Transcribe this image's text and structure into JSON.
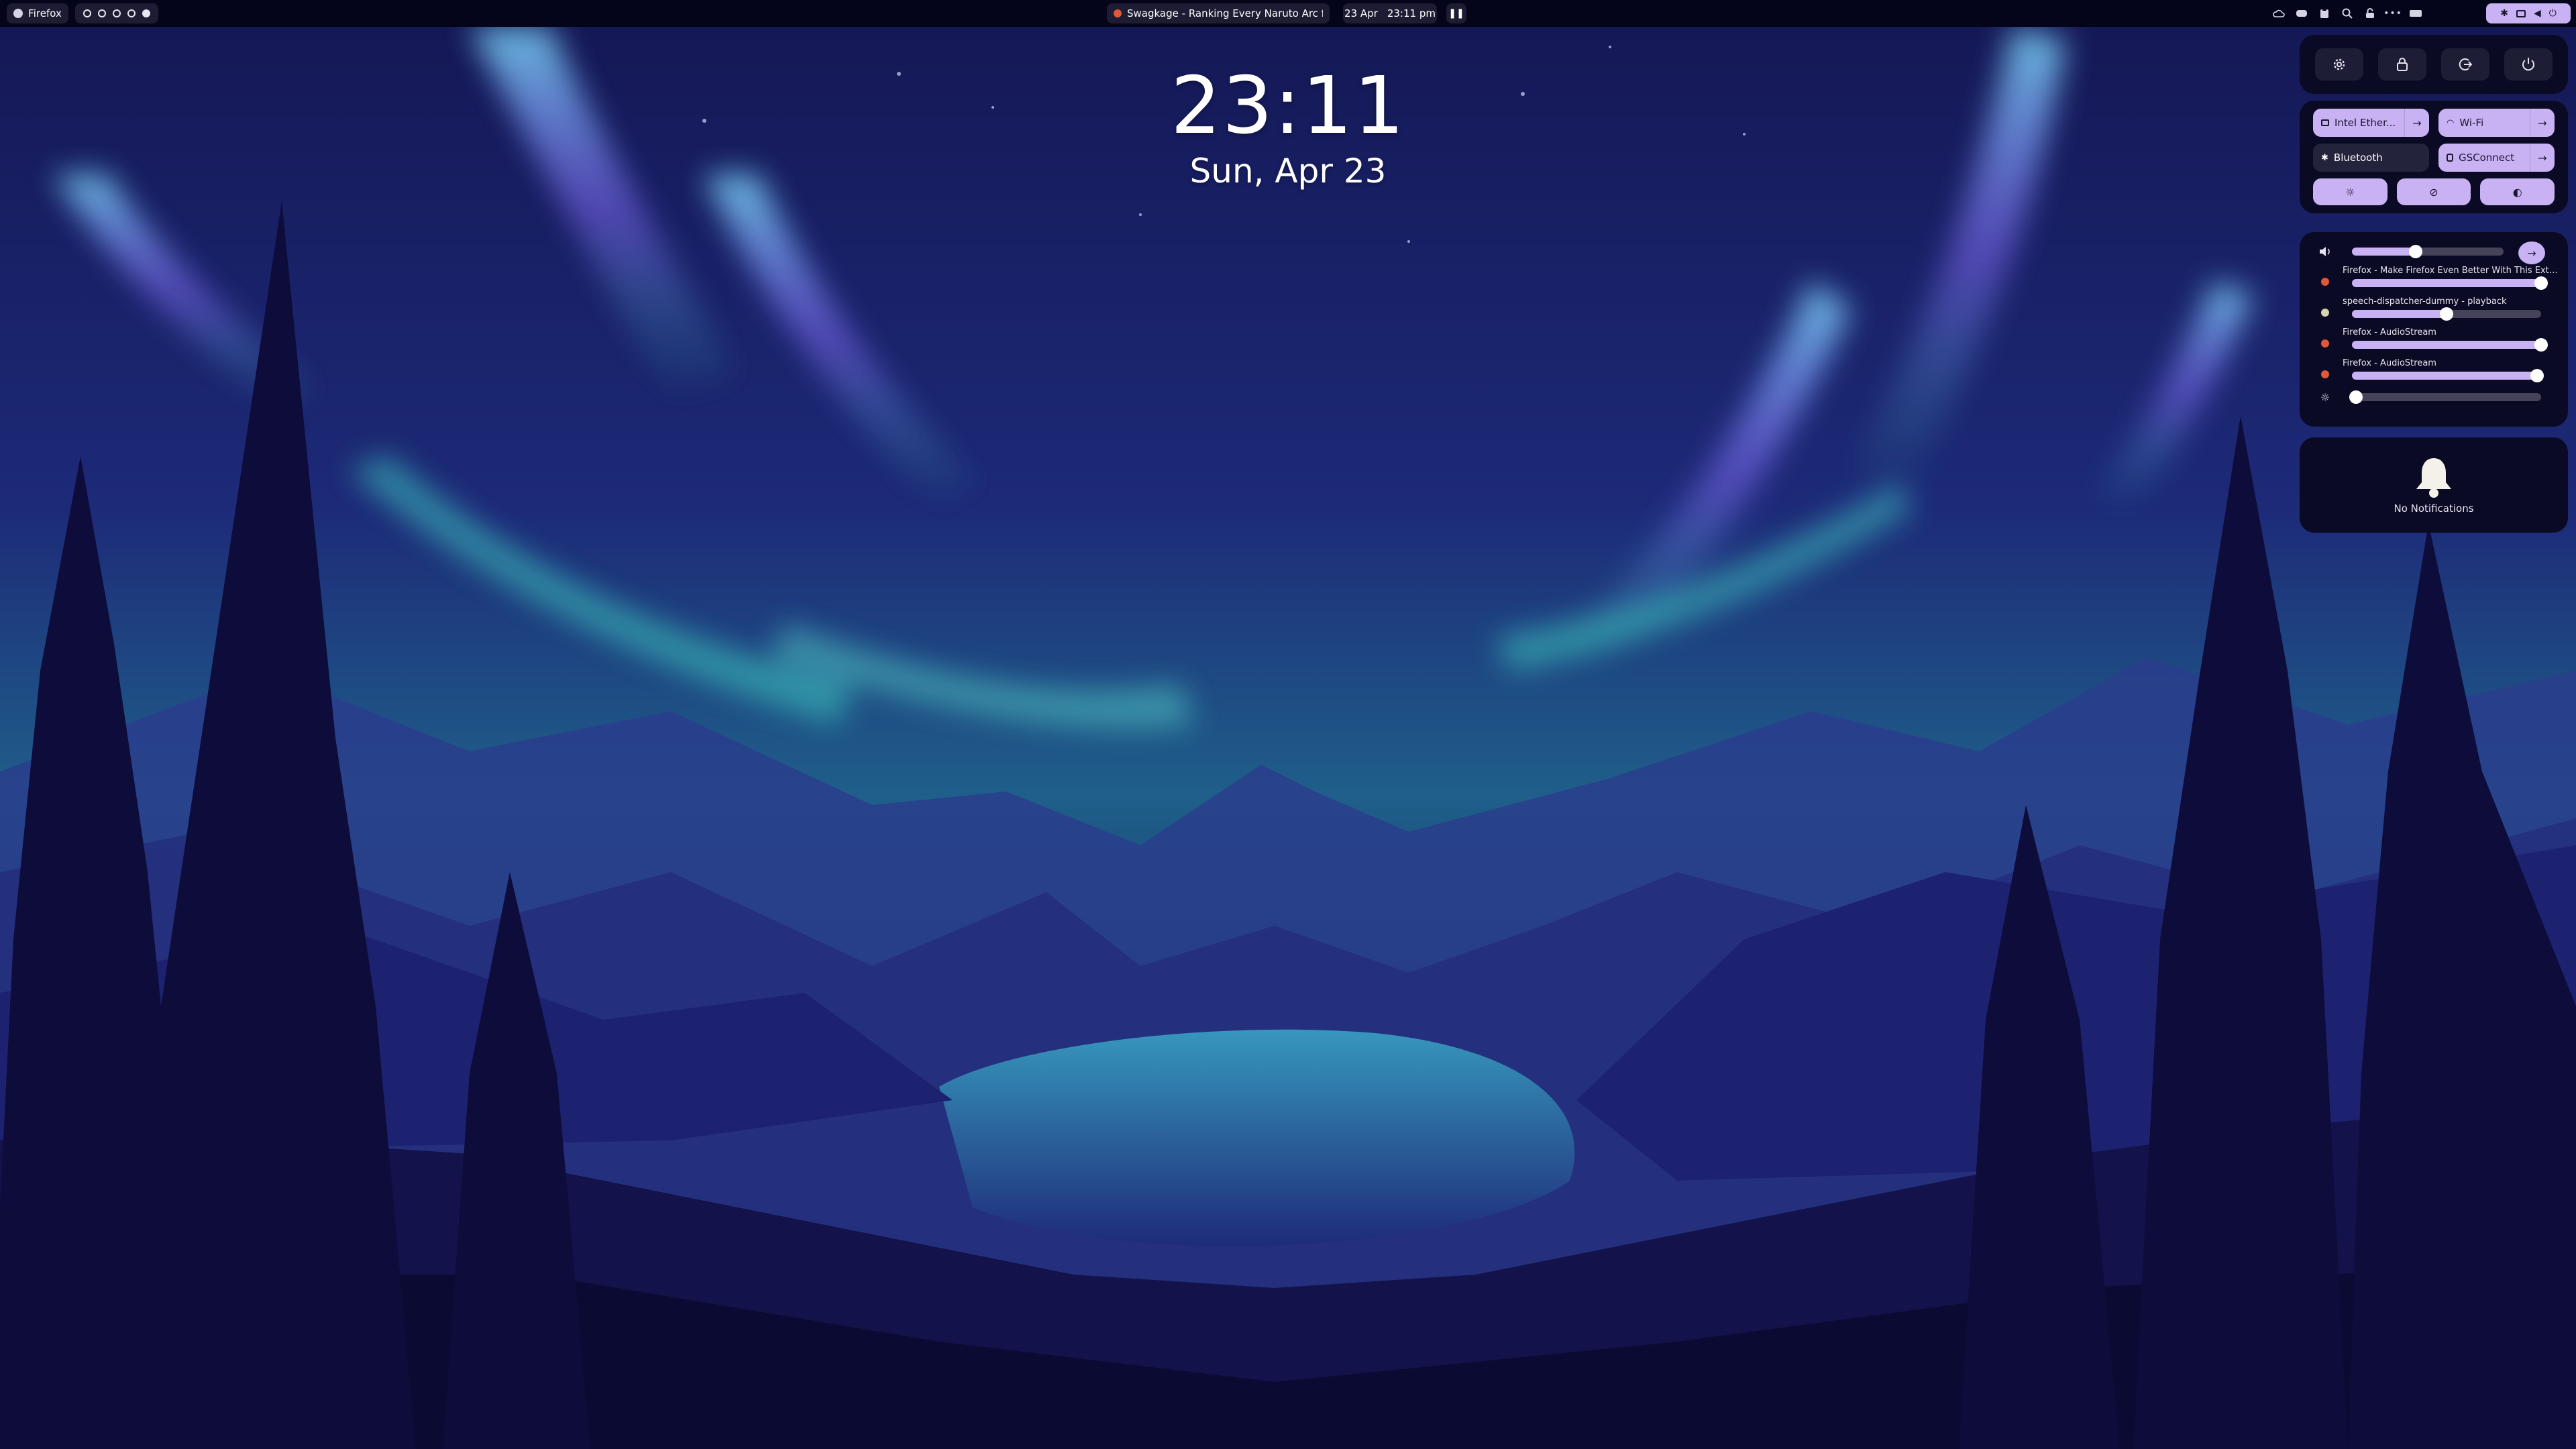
{
  "topbar": {
    "app_name": "Firefox",
    "workspaces": [
      {
        "active": false
      },
      {
        "active": false
      },
      {
        "active": false
      },
      {
        "active": false
      },
      {
        "active": true
      }
    ],
    "media_title": "Swagkage - Ranking Every Naruto Arc fro...",
    "date_short": "23 Apr",
    "time_short": "23:11 pm"
  },
  "clock": {
    "time": "23:11",
    "date": "Sun, Apr 23"
  },
  "quick_settings": {
    "toggles": {
      "ethernet": "Intel Ether...",
      "wifi": "Wi-Fi",
      "bluetooth": "Bluetooth",
      "gsconnect": "GSConnect"
    },
    "volume": {
      "master_level": 0.42,
      "streams": [
        {
          "name": "Firefox - Make Firefox Even Better With This Exte...",
          "level": 1.0
        },
        {
          "name": "speech-dispatcher-dummy - playback",
          "level": 0.5
        },
        {
          "name": "Firefox - AudioStream",
          "level": 1.0
        },
        {
          "name": "Firefox - AudioStream",
          "level": 0.98
        }
      ],
      "brightness_level": 0.02
    },
    "notifications": {
      "empty_text": "No Notifications"
    }
  },
  "colors": {
    "accent": "#c9b2f4",
    "panel_bg": "#0a0a24",
    "topbar_bg": "#04041a"
  }
}
